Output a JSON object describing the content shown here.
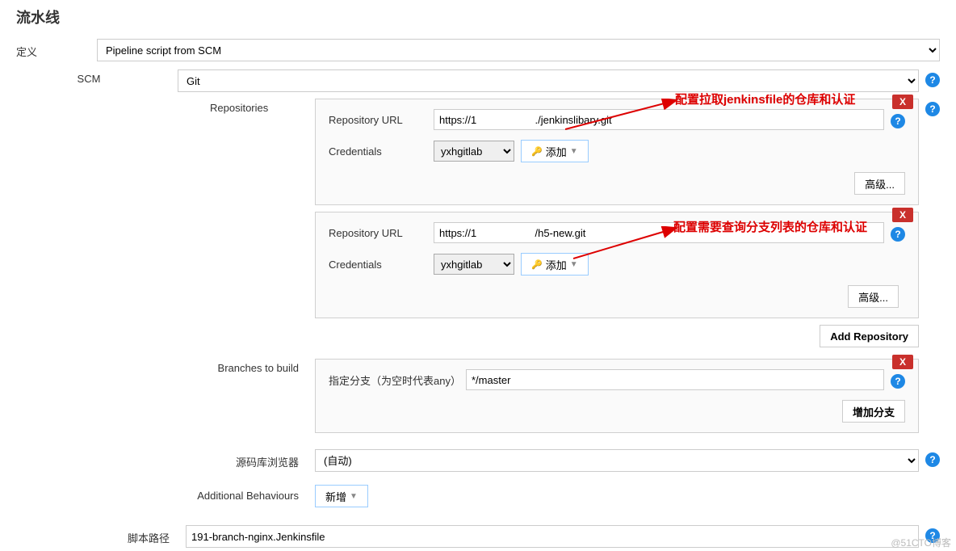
{
  "section_title": "流水线",
  "definition": {
    "label": "定义",
    "value": "Pipeline script from SCM"
  },
  "scm": {
    "label": "SCM",
    "value": "Git"
  },
  "repositories": {
    "label": "Repositories",
    "repo_url_label": "Repository URL",
    "credentials_label": "Credentials",
    "add_label": "添加",
    "advanced_label": "高级...",
    "add_repository_label": "Add Repository",
    "cred_value": "yxhgitlab",
    "repo1_url": "https://1                    ./jenkinslibary.git",
    "repo2_url": "https://1                    /h5-new.git"
  },
  "branches": {
    "label": "Branches to build",
    "branch_label": "指定分支（为空时代表any）",
    "branch_value": "*/master",
    "add_branch_label": "增加分支"
  },
  "browser": {
    "label": "源码库浏览器",
    "value": "(自动)"
  },
  "behaviours": {
    "label": "Additional Behaviours",
    "add_label": "新增"
  },
  "script_path": {
    "label": "脚本路径",
    "value": "191-branch-nginx.Jenkinsfile"
  },
  "annotations": {
    "a1": "配置拉取jenkinsfile的仓库和认证",
    "a2": "配置需要查询分支列表的仓库和认证"
  },
  "watermark": "@51CTO博客"
}
